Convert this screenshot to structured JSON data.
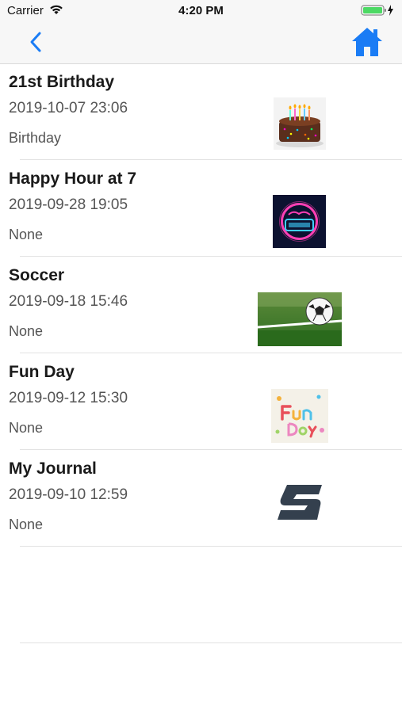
{
  "status_bar": {
    "carrier": "Carrier",
    "time": "4:20 PM",
    "wifi_icon": "wifi-icon",
    "battery_icon": "battery-charging-icon"
  },
  "nav": {
    "back_icon": "chevron-left-icon",
    "home_icon": "home-icon",
    "accent_color": "#1a7cf5"
  },
  "entries": [
    {
      "title": "21st Birthday",
      "date": "2019-10-07 23:06",
      "category": "Birthday",
      "thumbnail": "birthday-cake-image"
    },
    {
      "title": "Happy Hour at 7",
      "date": "2019-09-28 19:05",
      "category": "None",
      "thumbnail": "happy-hour-neon-image"
    },
    {
      "title": "Soccer",
      "date": "2019-09-18 15:46",
      "category": "None",
      "thumbnail": "soccer-ball-image"
    },
    {
      "title": "Fun Day",
      "date": "2019-09-12 15:30",
      "category": "None",
      "thumbnail": "fun-day-image"
    },
    {
      "title": "My Journal",
      "date": "2019-09-10 12:59",
      "category": "None",
      "thumbnail": "journal-logo-image"
    }
  ]
}
